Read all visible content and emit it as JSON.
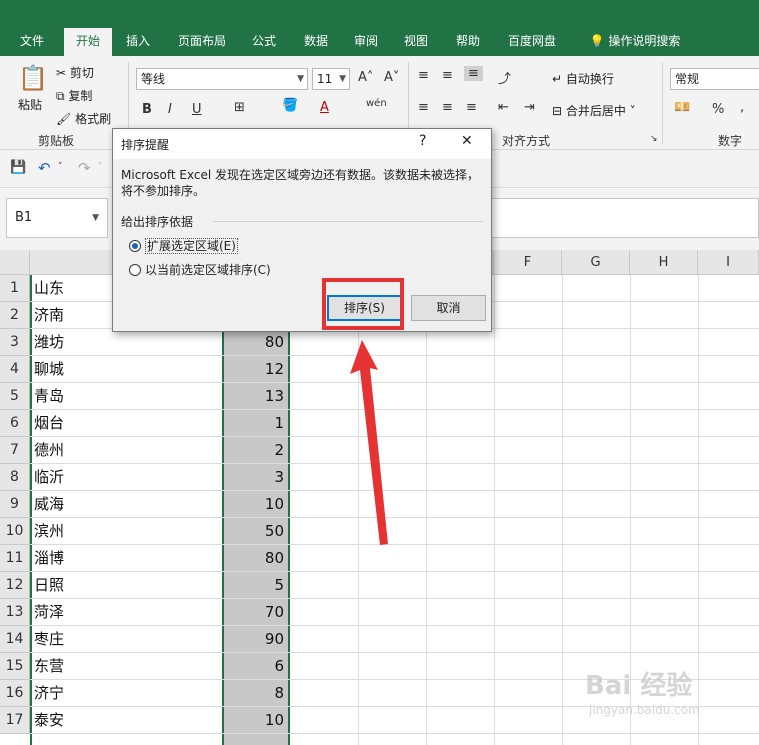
{
  "tabs": [
    "文件",
    "开始",
    "插入",
    "页面布局",
    "公式",
    "数据",
    "审阅",
    "视图",
    "帮助",
    "百度网盘",
    "操作说明搜索"
  ],
  "active_tab": "开始",
  "ribbon": {
    "clipboard": {
      "paste": "粘贴",
      "cut": "剪切",
      "copy": "复制",
      "format_painter": "格式刷",
      "label": "剪贴板"
    },
    "font": {
      "name": "等线",
      "size": "11",
      "bold": "B",
      "italic": "I",
      "underline": "U",
      "phonetic": "wén"
    },
    "alignment": {
      "wrap": "自动换行",
      "merge": "合并后居中",
      "label": "对齐方式"
    },
    "number": {
      "format": "常规",
      "percent": "%",
      "comma": ",",
      "label": "数字"
    }
  },
  "name_box": "B1",
  "columns": [
    "F",
    "G",
    "H",
    "I"
  ],
  "rows": [
    {
      "n": "1",
      "city": "山东",
      "value": ""
    },
    {
      "n": "2",
      "city": "济南",
      "value": ""
    },
    {
      "n": "3",
      "city": "潍坊",
      "value": "80"
    },
    {
      "n": "4",
      "city": "聊城",
      "value": "12"
    },
    {
      "n": "5",
      "city": "青岛",
      "value": "13"
    },
    {
      "n": "6",
      "city": "烟台",
      "value": "1"
    },
    {
      "n": "7",
      "city": "德州",
      "value": "2"
    },
    {
      "n": "8",
      "city": "临沂",
      "value": "3"
    },
    {
      "n": "9",
      "city": "威海",
      "value": "10"
    },
    {
      "n": "10",
      "city": "滨州",
      "value": "50"
    },
    {
      "n": "11",
      "city": "淄博",
      "value": "80"
    },
    {
      "n": "12",
      "city": "日照",
      "value": "5"
    },
    {
      "n": "13",
      "city": "菏泽",
      "value": "70"
    },
    {
      "n": "14",
      "city": "枣庄",
      "value": "90"
    },
    {
      "n": "15",
      "city": "东营",
      "value": "6"
    },
    {
      "n": "16",
      "city": "济宁",
      "value": "8"
    },
    {
      "n": "17",
      "city": "泰安",
      "value": "10"
    }
  ],
  "dialog": {
    "title": "排序提醒",
    "help": "?",
    "close": "✕",
    "message": "Microsoft Excel 发现在选定区域旁边还有数据。该数据未被选择，将不参加排序。",
    "group_label": "给出排序依据",
    "option1": "扩展选定区域(E)",
    "option2": "以当前选定区域排序(C)",
    "sort_button": "排序(S)",
    "cancel_button": "取消"
  },
  "watermark": {
    "brand": "Bai 经验",
    "url": "jingyan.baidu.com"
  },
  "colors": {
    "excel_green": "#217346",
    "highlight_red": "#e53333",
    "selection_gray": "#c8c8c8"
  }
}
